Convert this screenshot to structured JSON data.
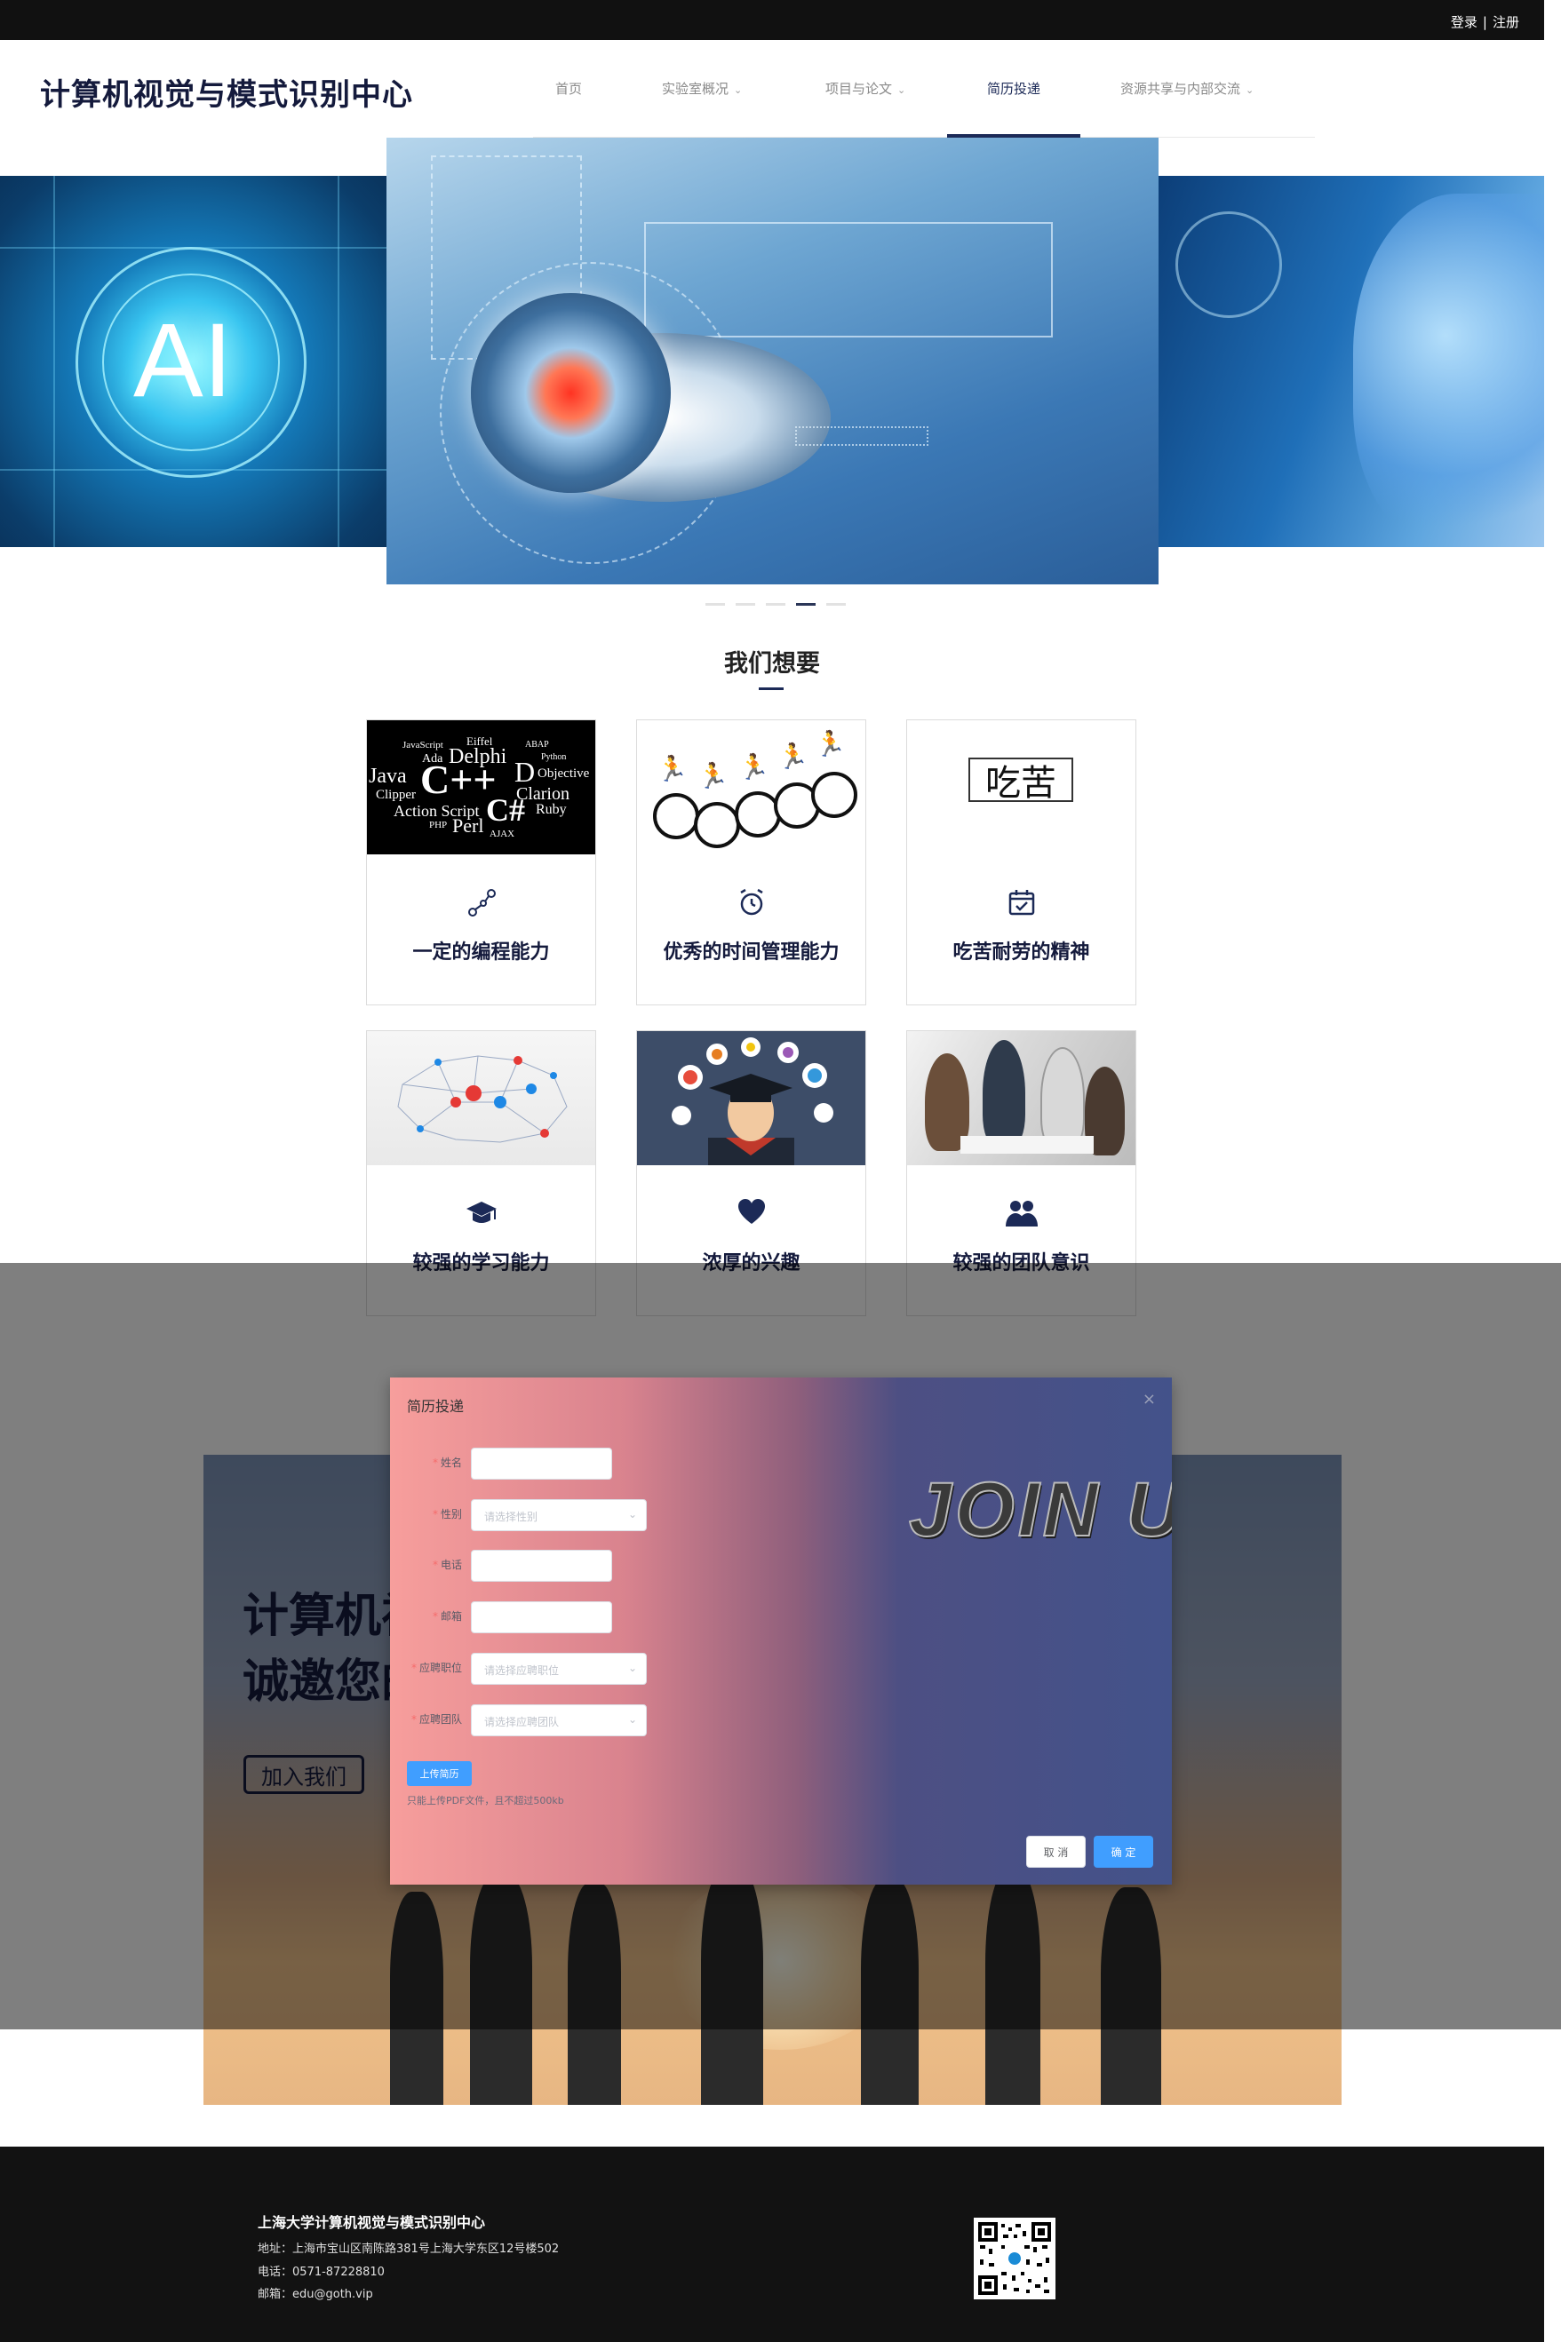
{
  "topbar": {
    "login": "登录",
    "separator": "|",
    "register": "注册"
  },
  "header": {
    "logo": "计算机视觉与模式识别中心",
    "nav": [
      {
        "label": "首页",
        "has_dropdown": false
      },
      {
        "label": "实验室概况",
        "has_dropdown": true
      },
      {
        "label": "项目与论文",
        "has_dropdown": true
      },
      {
        "label": "简历投递",
        "has_dropdown": false,
        "active": true
      },
      {
        "label": "资源共享与内部交流",
        "has_dropdown": true
      }
    ]
  },
  "carousel": {
    "slide_count": 5,
    "active_index": 3
  },
  "wants": {
    "title": "我们想要",
    "items": [
      {
        "label": "一定的编程能力",
        "icon": "nodes-icon"
      },
      {
        "label": "优秀的时间管理能力",
        "icon": "alarm-clock-icon"
      },
      {
        "label": "吃苦耐劳的精神",
        "icon": "calendar-check-icon"
      },
      {
        "label": "较强的学习能力",
        "icon": "graduation-cap-icon"
      },
      {
        "label": "浓厚的兴趣",
        "icon": "heart-icon"
      },
      {
        "label": "较强的团队意识",
        "icon": "team-icon"
      }
    ],
    "code_words": [
      "Eiffel",
      "Delphi",
      "Java",
      "C++",
      "D",
      "Objective",
      "Clarion",
      "Clipper",
      "Action Script",
      "C#",
      "Ruby",
      "Perl",
      "Ada",
      "JavaScript",
      "AJAX",
      "ABAP",
      "Python",
      "PHP"
    ],
    "kanji": "吃苦"
  },
  "join": {
    "title_line1": "计算机视觉与模式识别中心",
    "title_line2": "诚邀您的加入",
    "button": "加入我们"
  },
  "modal": {
    "title": "简历投递",
    "close": "×",
    "banner_text": "JOIN US",
    "fields": [
      {
        "label": "姓名",
        "type": "text",
        "placeholder": "",
        "value": ""
      },
      {
        "label": "性别",
        "type": "select",
        "placeholder": "请选择性别",
        "value": ""
      },
      {
        "label": "电话",
        "type": "text",
        "placeholder": "",
        "value": ""
      },
      {
        "label": "邮箱",
        "type": "text",
        "placeholder": "",
        "value": ""
      },
      {
        "label": "应聘职位",
        "type": "select",
        "placeholder": "请选择应聘职位",
        "value": ""
      },
      {
        "label": "应聘团队",
        "type": "select",
        "placeholder": "请选择应聘团队",
        "value": ""
      }
    ],
    "upload_button": "上传简历",
    "upload_tip": "只能上传PDF文件，且不超过500kb",
    "cancel": "取 消",
    "confirm": "确 定",
    "colors": {
      "primary": "#409eff",
      "required": "#f56c6c"
    }
  },
  "footer": {
    "org": "上海大学计算机视觉与模式识别中心",
    "address": "地址：上海市宝山区南陈路381号上海大学东区12号楼502",
    "phone": "电话：0571-87228810",
    "email": "邮箱：edu@goth.vip"
  },
  "colors": {
    "brand": "#1c2a57",
    "topbar": "#111111",
    "footer": "#121212"
  }
}
